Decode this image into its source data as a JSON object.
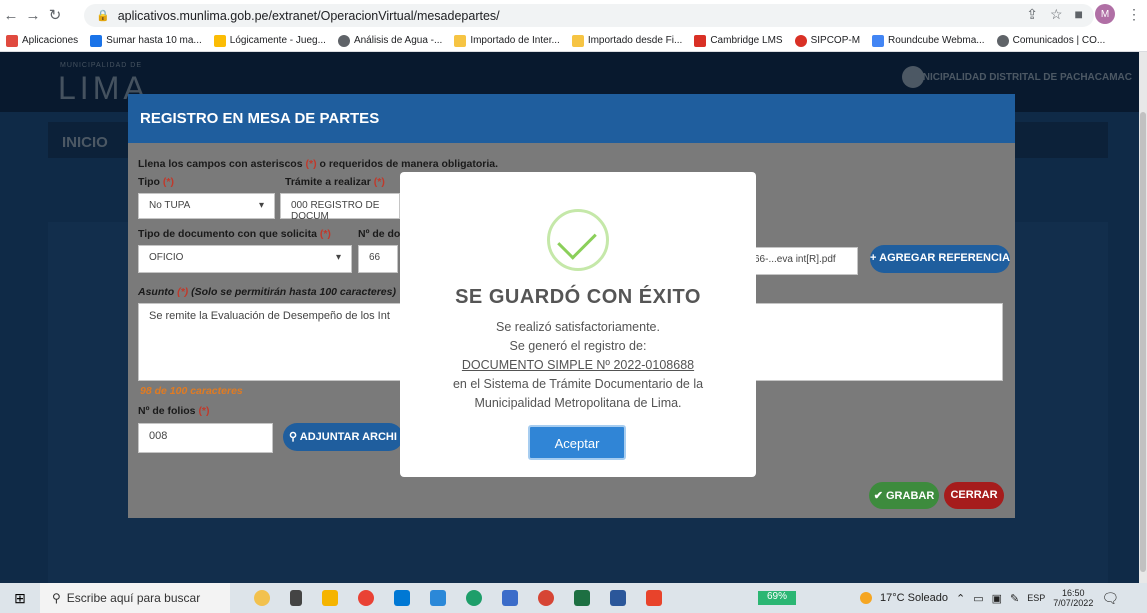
{
  "browser": {
    "url": "aplicativos.munlima.gob.pe/extranet/OperacionVirtual/mesadepartes/",
    "profile_initial": "M",
    "bookmarks": [
      {
        "label": "Aplicaciones",
        "color": "#e04a3f"
      },
      {
        "label": "Sumar hasta 10 ma...",
        "color": "#1a73e8"
      },
      {
        "label": "Lógicamente - Jueg...",
        "color": "#fbbc04"
      },
      {
        "label": "Análisis de Agua -...",
        "color": "#5f6368"
      },
      {
        "label": "Importado de Inter...",
        "color": "#f6c443"
      },
      {
        "label": "Importado desde Fi...",
        "color": "#f6c443"
      },
      {
        "label": "Cambridge LMS",
        "color": "#d93025"
      },
      {
        "label": "SIPCOP-M",
        "color": "#d93025"
      },
      {
        "label": "Roundcube Webma...",
        "color": "#4285f4"
      },
      {
        "label": "Comunicados | CO...",
        "color": "#5f6368"
      }
    ]
  },
  "site": {
    "brand": "LIMA",
    "brand_small": "MUNICIPALIDAD DE",
    "header_right": "MUNICIPALIDAD DISTRITAL DE PACHACAMAC",
    "inicio": "INICIO"
  },
  "modal": {
    "title": "REGISTRO EN MESA DE PARTES",
    "instructions_pre": "Llena los campos con asteriscos ",
    "instructions_req": "(*)",
    "instructions_post": " o requeridos de manera obligatoria.",
    "tipo_label": "Tipo",
    "tipo_value": "No TUPA",
    "tramite_label": "Trámite a realizar",
    "tramite_value": "000 REGISTRO DE DOCUM",
    "tipo_doc_label": "Tipo de documento con que solicita",
    "tipo_doc_value": "OFICIO",
    "num_doc_label": "Nº de doc",
    "num_doc_value": "66",
    "file_value": "66-...eva int[R].pdf",
    "agregar_btn": "AGREGAR REFERENCIA",
    "asunto_label": "Asunto",
    "asunto_hint": "(Solo se permitirán hasta 100 caracteres)",
    "asunto_value": "Se remite la Evaluación de Desempeño de los Int",
    "char_count": "98 de 100 caracteres",
    "folios_label": "Nº de folios",
    "folios_value": "008",
    "adjuntar_btn": "ADJUNTAR ARCHI",
    "grabar_btn": "GRABAR",
    "cerrar_btn": "CERRAR",
    "required_mark": "(*)"
  },
  "dialog": {
    "title": "SE GUARDÓ CON ÉXITO",
    "line1": "Se realizó satisfactoriamente.",
    "line2": "Se generó el registro de:",
    "doc_ref": "DOCUMENTO SIMPLE Nº 2022-0108688",
    "line3": "en el Sistema de Trámite Documentario de la",
    "line4": "Municipalidad Metropolitana de Lima.",
    "ok_btn": "Aceptar"
  },
  "taskbar": {
    "search_placeholder": "Escribe aquí para buscar",
    "battery": "69%",
    "weather": "17°C Soleado",
    "lang": "ESP",
    "time": "16:50",
    "date": "7/07/2022"
  }
}
